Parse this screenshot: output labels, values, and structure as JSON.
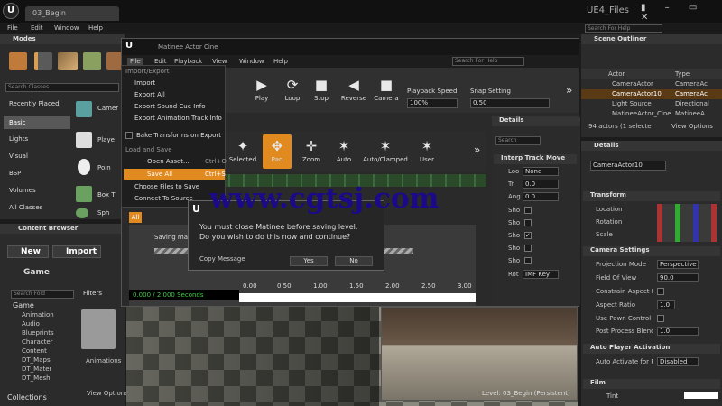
{
  "app": {
    "tab": "03_Begin",
    "brand": "UE4_Files",
    "menu": [
      "File",
      "Edit",
      "Window",
      "Help"
    ],
    "search_placeholder": "Search For Help"
  },
  "modes": {
    "title": "Modes",
    "search_placeholder": "Search Classes",
    "categories": [
      "Recently Placed",
      "Basic",
      "Lights",
      "Visual",
      "BSP",
      "Volumes",
      "All Classes"
    ],
    "items": [
      "Camer",
      "Playe",
      "Poin",
      "Box T",
      "Sph"
    ]
  },
  "outliner": {
    "title": "Scene Outliner",
    "col_actor": "Actor",
    "col_type": "Type",
    "rows": [
      {
        "a": "CameraActor",
        "t": "CameraAc"
      },
      {
        "a": "CameraActor10",
        "t": "CameraAc"
      },
      {
        "a": "Light Source",
        "t": "Directional"
      },
      {
        "a": "MatineeActor_Cine",
        "t": "MatineeA"
      }
    ],
    "status": "94 actors (1 selecte",
    "view": "View Options"
  },
  "details": {
    "title": "Details",
    "search_placeholder": "Search",
    "name": "CameraActor10",
    "transform": "Transform",
    "location": "Location",
    "rotation": "Rotation",
    "scale": "Scale",
    "camera_settings": "Camera Settings",
    "proj_mode": "Projection Mode",
    "proj_val": "Perspective",
    "fov": "Field Of View",
    "fov_val": "90.0",
    "constrain": "Constrain Aspect Ra",
    "aspect": "Aspect Ratio",
    "aspect_val": "1.0",
    "pawn": "Use Pawn Control R",
    "post": "Post Process Blend",
    "post_val": "1.0",
    "auto": "Auto Player Activation",
    "auto_label": "Auto Activate for Pl",
    "auto_val": "Disabled",
    "film": "Film",
    "tint": "Tint"
  },
  "browser": {
    "title": "Content Browser",
    "new": "New",
    "import": "Import",
    "path": "Game",
    "filters": "Filters",
    "search_placeholder": "Search Fold",
    "tree": [
      "Game",
      "Animation",
      "Audio",
      "Blueprints",
      "Character",
      "Content",
      "DT_Maps",
      "DT_Mater",
      "DT_Mesh"
    ],
    "asset": "Animations",
    "view": "View Options",
    "collections": "Collections"
  },
  "matinee": {
    "title": "Matinee Actor Cine",
    "menu": [
      "File",
      "Edit",
      "Playback",
      "View",
      "Window",
      "Help"
    ],
    "toolbar": [
      "Play",
      "Loop",
      "Stop",
      "Reverse",
      "Camera"
    ],
    "speed_label": "Playback Speed:",
    "speed_val": "100%",
    "snap_label": "Snap Setting",
    "snap_val": "0.50",
    "toolbar2": [
      "Selected",
      "Pan",
      "Zoom",
      "Auto",
      "Auto/Clamped",
      "User"
    ],
    "all": "All",
    "saving": "Saving map",
    "time": "0.000 / 2.000 Seconds",
    "ruler": [
      "0.00",
      "0.50",
      "1.00",
      "1.50",
      "2.00",
      "2.50",
      "3.00"
    ]
  },
  "file_menu": {
    "section1": "Import/Export",
    "items": [
      "Import",
      "Export All",
      "Export Sound Cue Info",
      "Export Animation Track Info"
    ],
    "bake": "Bake Transforms on Export",
    "section2": "Load and Save",
    "open": "Open Asset...",
    "open_key": "Ctrl+O",
    "save": "Save All",
    "save_key": "Ctrl+S",
    "choose": "Choose Files to Save",
    "connect": "Connect To Source"
  },
  "mdetails": {
    "title": "Details",
    "search_placeholder": "Search",
    "section": "Interp Track Move",
    "labels": [
      "Loo",
      "Tr",
      "Ang",
      "Sho",
      "Sho",
      "Sho",
      "Sho",
      "Sho",
      "Rot"
    ],
    "values": [
      "None",
      "0.0",
      "0.0"
    ],
    "rot": "IMF Key"
  },
  "dialog": {
    "message1": "You must close Matinee before saving level.",
    "message2": "Do you wish to do this now and continue?",
    "copy": "Copy Message",
    "yes": "Yes",
    "no": "No"
  },
  "viewport": {
    "level": "Level:  03_Begin (Persistent)"
  },
  "watermark": "www.cgtsj.com"
}
